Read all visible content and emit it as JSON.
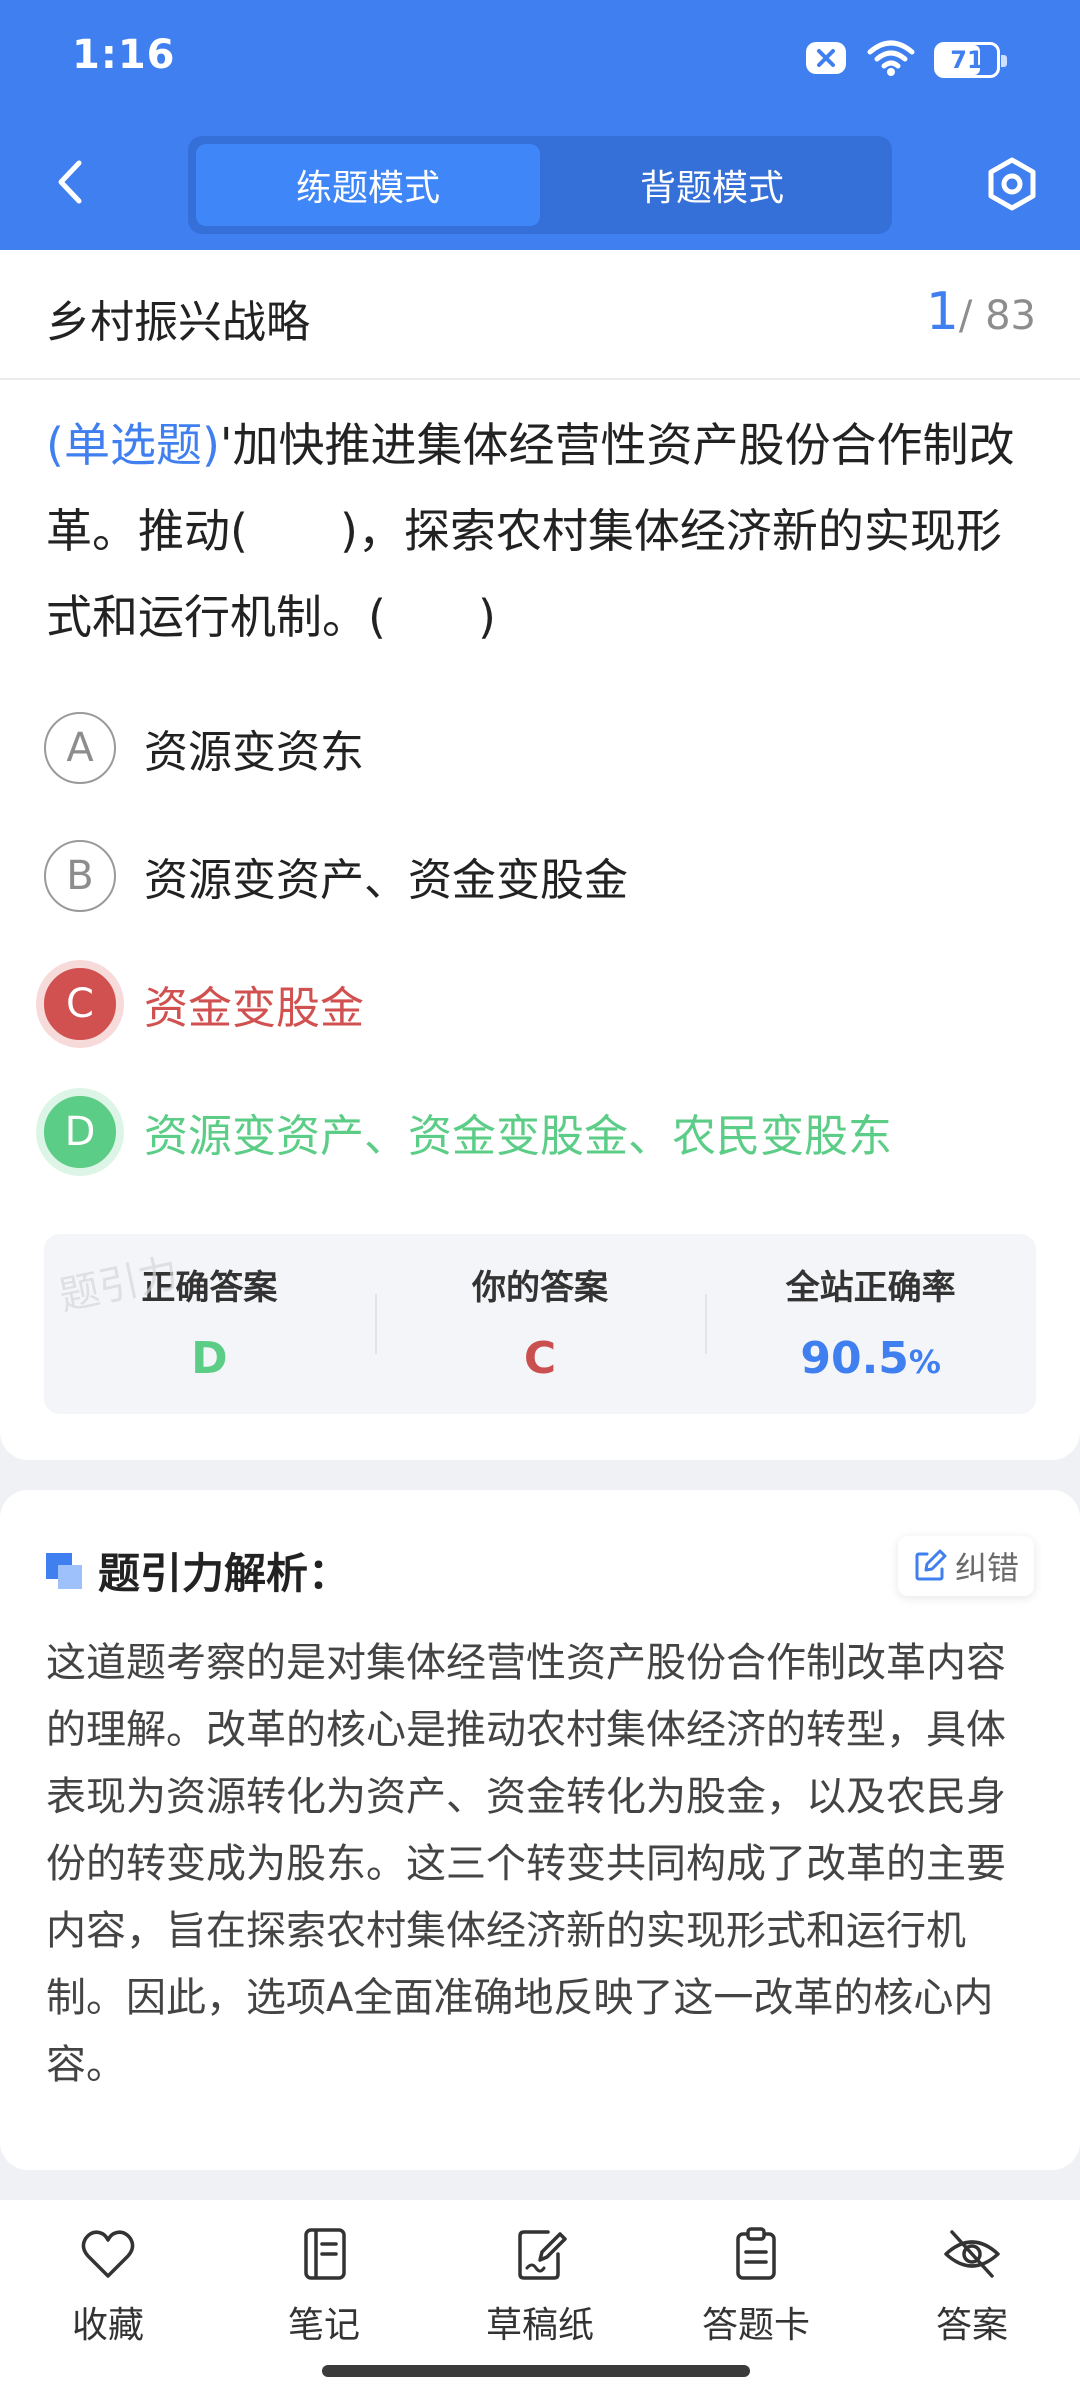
{
  "status": {
    "time": "1:16",
    "battery": "71",
    "battery_level": 0.71
  },
  "nav": {
    "tabs": [
      {
        "label": "练题模式",
        "active": true
      },
      {
        "label": "背题模式",
        "active": false
      }
    ]
  },
  "question": {
    "topic": "乡村振兴战略",
    "current": "1",
    "total": "/ 83",
    "type": "(单选题)",
    "text": "'加快推进集体经营性资产股份合作制改革。推动(　　)，探索农村集体经济新的实现形式和运行机制。(　　)",
    "options": [
      {
        "letter": "A",
        "text": "资源变资东",
        "state": "normal"
      },
      {
        "letter": "B",
        "text": "资源变资产、资金变股金",
        "state": "normal"
      },
      {
        "letter": "C",
        "text": "资金变股金",
        "state": "wrong"
      },
      {
        "letter": "D",
        "text": "资源变资产、资金变股金、农民变股东",
        "state": "right"
      }
    ],
    "result": {
      "correct_label": "正确答案",
      "correct_value": "D",
      "yours_label": "你的答案",
      "yours_value": "C",
      "rate_label": "全站正确率",
      "rate_value": "90.5",
      "rate_unit": "%"
    },
    "watermark": "题引力"
  },
  "analysis": {
    "title": "题引力解析：",
    "correct_button": "纠错",
    "body": "这道题考察的是对集体经营性资产股份合作制改革内容的理解。改革的核心是推动农村集体经济的转型，具体表现为资源转化为资产、资金转化为股金，以及农民身份的转变成为股东。这三个转变共同构成了改革的主要内容，旨在探索农村集体经济新的实现形式和运行机制。因此，选项A全面准确地反映了这一改革的核心内容。"
  },
  "toolbar": {
    "favorite": "收藏",
    "notes": "笔记",
    "draft": "草稿纸",
    "answer_card": "答题卡",
    "answer": "答案"
  },
  "colors": {
    "primary": "#3f7ff0",
    "wrong": "#d0514f",
    "right": "#5ccd86"
  }
}
